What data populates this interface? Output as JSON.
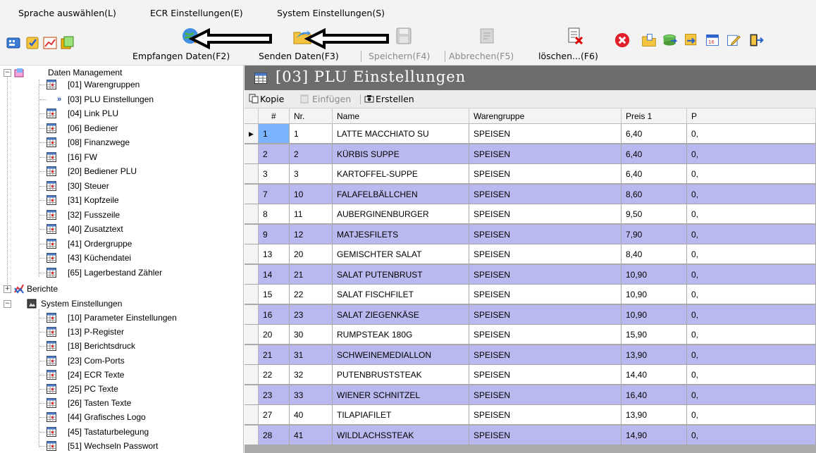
{
  "menu": [
    "Sprache auswählen(L)",
    "ECR Einstellungen(E)",
    "System Einstellungen(S)"
  ],
  "toolbar": {
    "receive_label": "Empfangen Daten(F2)",
    "send_label": "Senden Daten(F3)",
    "save_label": "Speichern(F4)",
    "cancel_label": "Abbrechen(F5)",
    "delete_label": "löschen...(F6)"
  },
  "tree": {
    "data_management": "Daten Management",
    "data_items": [
      "[01] Warengruppen",
      "[03] PLU Einstellungen",
      "[04] Link PLU",
      "[06] Bediener",
      "[08] Finanzwege",
      "[16] FW",
      "[20] Bediener PLU",
      "[30] Steuer",
      "[31] Kopfzeile",
      "[32] Fusszeile",
      "[40] Zusatztext",
      "[41] Ordergruppe",
      "[43] Küchendatei",
      "[65] Lagerbestand Zähler"
    ],
    "reports": "Berichte",
    "system_settings": "System Einstellungen",
    "system_items": [
      "[10] Parameter Einstellungen",
      "[13] P-Register",
      "[18] Berichtsdruck",
      "[23] Com-Ports",
      "[24] ECR Texte",
      "[25] PC Texte",
      "[26] Tasten Texte",
      "[44] Grafisches Logo",
      "[45] Tastaturbelegung",
      "[51] Wechseln Passwort"
    ]
  },
  "panel": {
    "title": "[03] PLU Einstellungen"
  },
  "grid_toolbar": {
    "copy": "Kopie",
    "paste": "Einfügen",
    "create": "Erstellen"
  },
  "grid": {
    "columns": [
      "#",
      "Nr.",
      "Name",
      "Warengruppe",
      "Preis 1",
      "P"
    ],
    "rows": [
      [
        "1",
        "1",
        "LATTE MACCHIATO SU",
        "SPEISEN",
        "6,40",
        "0,"
      ],
      [
        "2",
        "2",
        "KÜRBIS SUPPE",
        "SPEISEN",
        "6,40",
        "0,"
      ],
      [
        "3",
        "3",
        "KARTOFFEL-SUPPE",
        "SPEISEN",
        "6,40",
        "0,"
      ],
      [
        "7",
        "10",
        "FALAFELBÄLLCHEN",
        "SPEISEN",
        "8,60",
        "0,"
      ],
      [
        "8",
        "11",
        "AUBERGINENBURGER",
        "SPEISEN",
        "9,50",
        "0,"
      ],
      [
        "9",
        "12",
        "MATJESFILETS",
        "SPEISEN",
        "7,90",
        "0,"
      ],
      [
        "13",
        "20",
        "GEMISCHTER SALAT",
        "SPEISEN",
        "8,40",
        "0,"
      ],
      [
        "14",
        "21",
        "SALAT PUTENBRUST",
        "SPEISEN",
        "10,90",
        "0,"
      ],
      [
        "15",
        "22",
        "SALAT FISCHFILET",
        "SPEISEN",
        "10,90",
        "0,"
      ],
      [
        "16",
        "23",
        "SALAT ZIEGENKÄSE",
        "SPEISEN",
        "10,90",
        "0,"
      ],
      [
        "20",
        "30",
        "RUMPSTEAK 180G",
        "SPEISEN",
        "15,90",
        "0,"
      ],
      [
        "21",
        "31",
        "SCHWEINEMEDIALLON",
        "SPEISEN",
        "13,90",
        "0,"
      ],
      [
        "22",
        "32",
        "PUTENBRUSTSTEAK",
        "SPEISEN",
        "14,40",
        "0,"
      ],
      [
        "23",
        "33",
        "WIENER SCHNITZEL",
        "SPEISEN",
        "16,40",
        "0,"
      ],
      [
        "27",
        "40",
        "TILAPIAFILET",
        "SPEISEN",
        "13,90",
        "0,"
      ],
      [
        "28",
        "41",
        "WILDLACHSSTEAK",
        "SPEISEN",
        "14,90",
        "0,"
      ]
    ]
  },
  "colors": {
    "row_alt": "#b9b9ef",
    "title_bar": "#6d6d6d",
    "selected": "#7bb3ff"
  }
}
